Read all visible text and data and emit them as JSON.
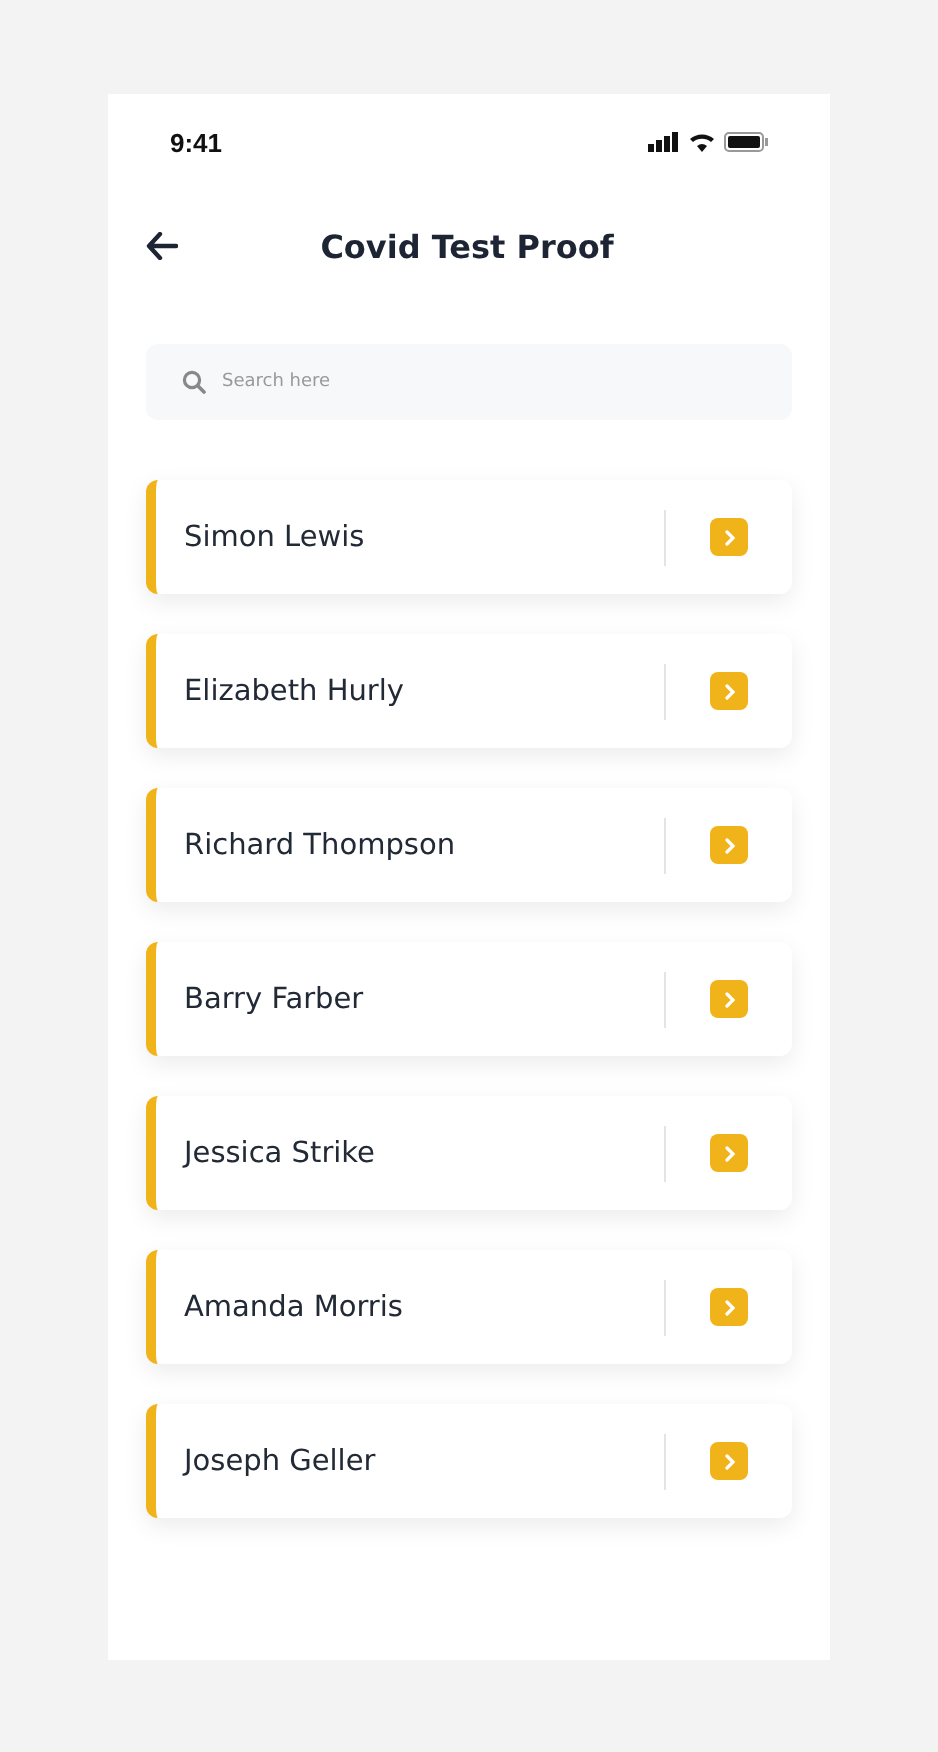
{
  "status_bar": {
    "time": "9:41"
  },
  "header": {
    "title": "Covid Test Proof"
  },
  "search": {
    "placeholder": "Search here"
  },
  "people": [
    {
      "name": "Simon Lewis"
    },
    {
      "name": "Elizabeth Hurly"
    },
    {
      "name": "Richard Thompson"
    },
    {
      "name": "Barry Farber"
    },
    {
      "name": "Jessica Strike"
    },
    {
      "name": "Amanda Morris"
    },
    {
      "name": "Joseph Geller"
    }
  ]
}
